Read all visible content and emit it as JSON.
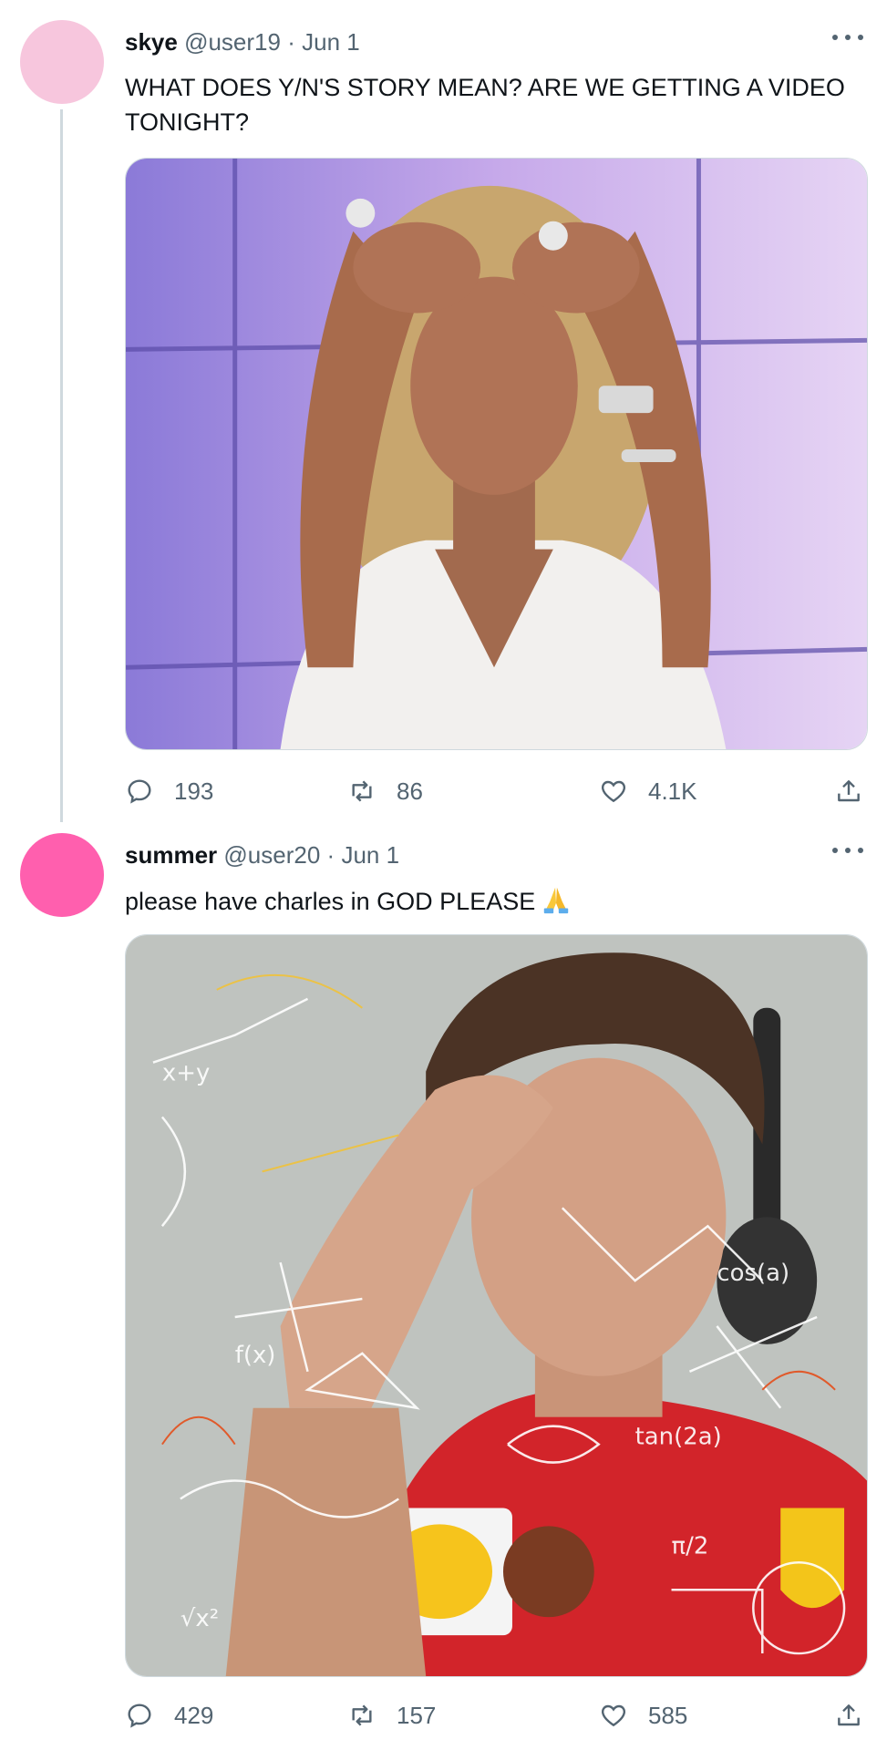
{
  "colors": {
    "text_primary": "#0f1419",
    "text_secondary": "#536471",
    "thread_line": "#cfd9de"
  },
  "tweets": [
    {
      "avatar_color": "#f7c6dd",
      "name": "skye",
      "handle": "@user19",
      "separator": "·",
      "date": "Jun 1",
      "text": "WHAT DOES Y/N'S STORY MEAN? ARE WE GETTING A VIDEO TONIGHT?",
      "media_description_icon": "photo",
      "reply_icon": "reply-icon",
      "replies": "193",
      "retweets": "86",
      "likes": "4.1K"
    },
    {
      "avatar_color": "#ff5fae",
      "name": "summer",
      "handle": "@user20",
      "separator": "·",
      "date": "Jun 1",
      "text": "please have charles in GOD PLEASE",
      "emoji": "folded-hands-emoji",
      "replies": "429",
      "retweets": "157",
      "likes": "585"
    }
  ]
}
